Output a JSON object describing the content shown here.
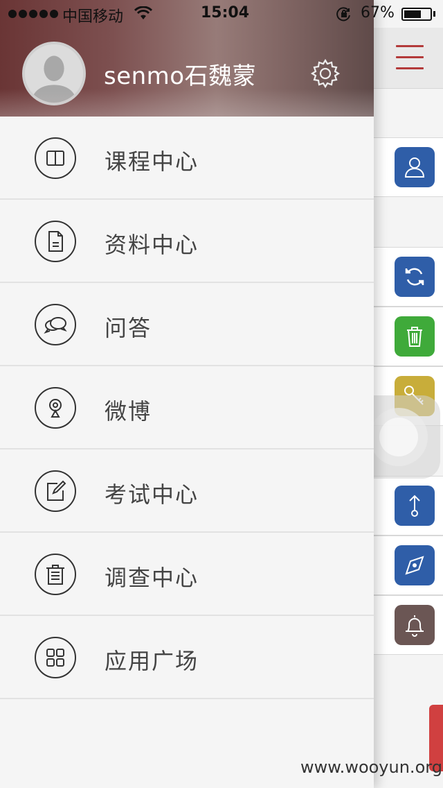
{
  "status_bar": {
    "carrier": "中国移动",
    "time": "15:04",
    "battery": "67%",
    "battery_level": 0.67
  },
  "profile": {
    "username": "senmo石魏蒙"
  },
  "menu": {
    "items": [
      {
        "label": "课程中心",
        "icon": "book-icon"
      },
      {
        "label": "资料中心",
        "icon": "document-icon"
      },
      {
        "label": "问答",
        "icon": "chat-bubbles-icon"
      },
      {
        "label": "微博",
        "icon": "weibo-icon"
      },
      {
        "label": "考试中心",
        "icon": "edit-icon"
      },
      {
        "label": "调查中心",
        "icon": "survey-icon"
      },
      {
        "label": "应用广场",
        "icon": "apps-grid-icon"
      }
    ]
  },
  "right_panel": {
    "tiles": [
      {
        "icon": "user-icon",
        "color": "#2f5ea8"
      },
      {
        "icon": "refresh-icon",
        "color": "#2f5ea8"
      },
      {
        "icon": "trash-icon",
        "color": "#3faa3a"
      },
      {
        "icon": "key-icon",
        "color": "#c8ad3a"
      },
      {
        "icon": "upload-icon",
        "color": "#2f5ea8"
      },
      {
        "icon": "compass-icon",
        "color": "#2f5ea8"
      },
      {
        "icon": "bell-icon",
        "color": "#6b5654"
      }
    ]
  },
  "watermark": "www.wooyun.org"
}
